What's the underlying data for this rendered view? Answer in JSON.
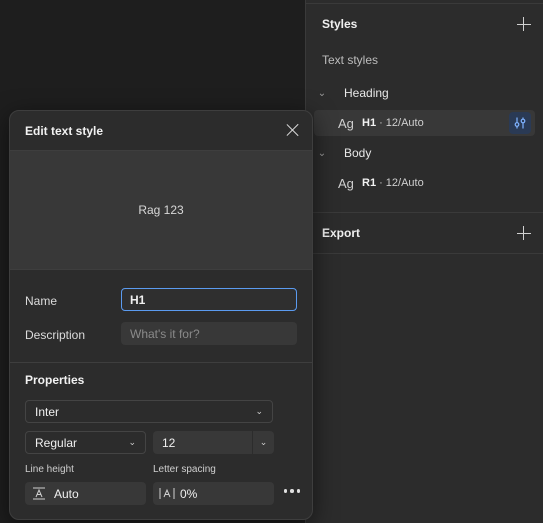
{
  "panel": {
    "styles_title": "Styles",
    "text_styles_label": "Text styles",
    "groups": [
      {
        "name": "Heading",
        "styles": [
          {
            "sample": "Ag",
            "name": "H1",
            "desc": "· 12/Auto"
          }
        ]
      },
      {
        "name": "Body",
        "styles": [
          {
            "sample": "Ag",
            "name": "R1",
            "desc": "· 12/Auto"
          }
        ]
      }
    ],
    "export_title": "Export"
  },
  "modal": {
    "title": "Edit text style",
    "preview_text": "Rag 123",
    "name_label": "Name",
    "name_value": "H1",
    "description_label": "Description",
    "description_placeholder": "What's it for?",
    "properties_label": "Properties",
    "font_family": "Inter",
    "font_weight": "Regular",
    "font_size": "12",
    "line_height_label": "Line height",
    "line_height_value": "Auto",
    "letter_spacing_label": "Letter spacing",
    "letter_spacing_value": "0%"
  },
  "colors": {
    "accent": "#5b9bf0",
    "panel_bg": "#2c2c2c",
    "canvas_bg": "#1e1e1e"
  }
}
